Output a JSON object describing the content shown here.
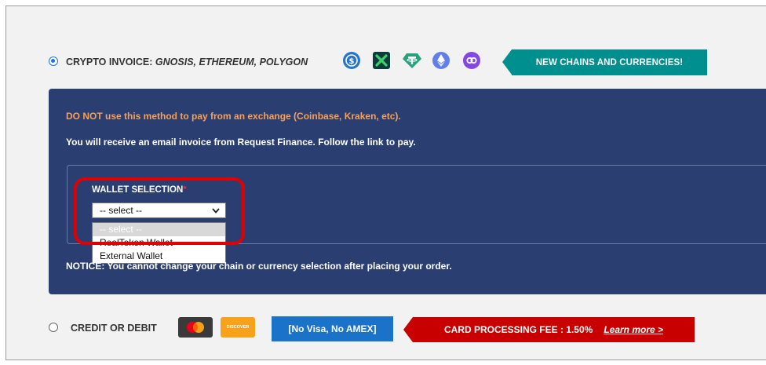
{
  "crypto_option": {
    "label_prefix": "CRYPTO INVOICE:",
    "label_chains": "GNOSIS, ETHEREUM, POLYGON",
    "icons": [
      "usdc-icon",
      "xdai-icon",
      "tether-icon",
      "ethereum-icon",
      "polygon-icon"
    ],
    "badge": "NEW CHAINS AND CURRENCIES!",
    "selected": true
  },
  "panel": {
    "warning": "DO NOT use this method to pay from an exchange (Coinbase, Kraken, etc).",
    "info": "You will receive an email invoice from Request Finance. Follow the link to pay.",
    "wallet_label": "WALLET SELECTION",
    "required_mark": "*",
    "select_value": "-- select --",
    "options": [
      "-- select --",
      "RealToken Wallet",
      "External Wallet"
    ],
    "notice_prefix": "NOTICE:",
    "notice_text": "You cannot change your chain or currency selection after placing your order."
  },
  "credit_option": {
    "label": "CREDIT OR DEBIT",
    "discover_text": "DISCOVER",
    "novisa": "[No Visa, No AMEX]",
    "fee_text": "CARD PROCESSING FEE : 1.50%",
    "learn_more": "Learn more >",
    "selected": false
  },
  "colors": {
    "panel": "#2b3e72",
    "teal_badge": "#008f8f",
    "warning_text": "#f6a158",
    "fee_badge": "#c80000",
    "novisa_badge": "#1a73c8",
    "highlight": "#e00000"
  }
}
